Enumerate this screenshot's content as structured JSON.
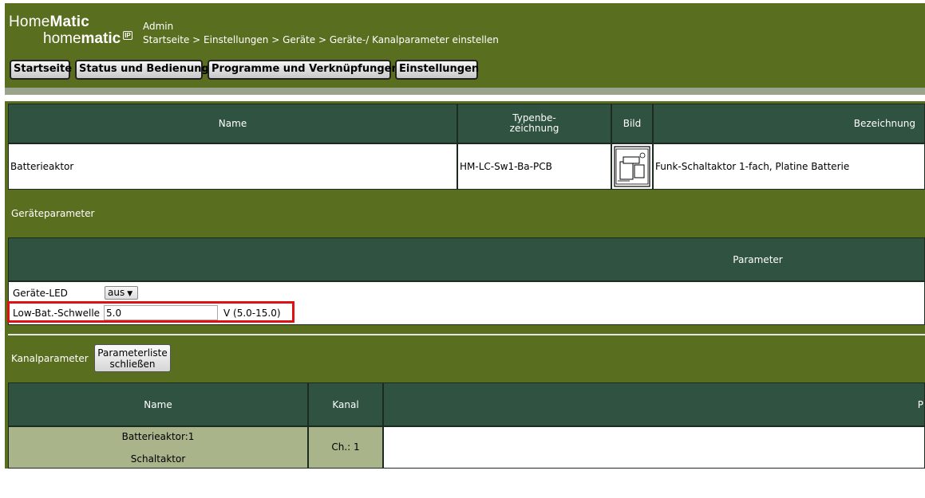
{
  "header": {
    "logo_top_regular": "Home",
    "logo_top_bold": "Matic",
    "logo_bottom_regular": "home",
    "logo_bottom_bold": "matic",
    "logo_badge": "IP",
    "user": "Admin",
    "breadcrumb": "Startseite > Einstellungen > Geräte > Geräte-/ Kanalparameter einstellen"
  },
  "nav": [
    {
      "label": "Startseite"
    },
    {
      "label": "Status und Bedienung"
    },
    {
      "label": "Programme und Verknüpfungen"
    },
    {
      "label": "Einstellungen"
    }
  ],
  "device_table": {
    "headers": {
      "name": "Name",
      "type_line1": "Typenbe-",
      "type_line2": "zeichnung",
      "image": "Bild",
      "description": "Bezeichnung"
    },
    "row": {
      "name": "Batterieaktor",
      "type": "HM-LC-Sw1-Ba-PCB",
      "image_icon": "device-board-icon",
      "description": "Funk-Schaltaktor 1-fach, Platine Batterie"
    }
  },
  "device_params": {
    "section_label": "Geräteparameter",
    "header": "Parameter",
    "led_label": "Geräte-LED",
    "led_value": "aus",
    "lowbat_label": "Low-Bat.-Schwelle",
    "lowbat_value": "5.0",
    "lowbat_range": "V (5.0-15.0)"
  },
  "channel_params": {
    "section_label": "Kanalparameter",
    "close_button_line1": "Parameterliste",
    "close_button_line2": "schließen",
    "headers": {
      "name": "Name",
      "channel": "Kanal",
      "param": "P"
    },
    "row": {
      "name_line1": "Batterieaktor:1",
      "name_line2": "Schaltaktor",
      "channel": "Ch.: 1"
    }
  },
  "colors": {
    "header_bg": "#5a6e1f",
    "table_header": "#2f5340",
    "channel_cell": "#a9b48a",
    "highlight": "#e11111"
  }
}
